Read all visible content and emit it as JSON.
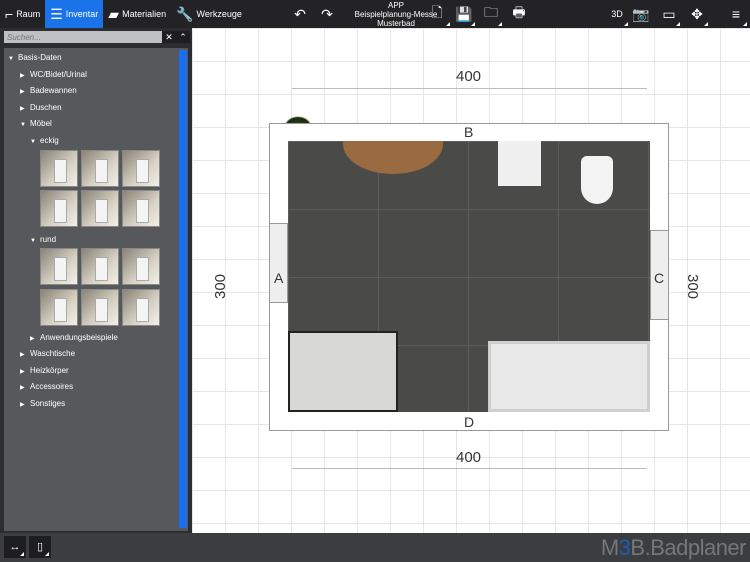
{
  "toolbar": {
    "tabs": [
      {
        "label": "Raum",
        "icon": "room-icon"
      },
      {
        "label": "Inventar",
        "icon": "list-icon",
        "active": true
      },
      {
        "label": "Materialien",
        "icon": "materials-icon"
      },
      {
        "label": "Werkzeuge",
        "icon": "wrench-icon"
      }
    ],
    "project": {
      "line1": "APP",
      "line2": "Beispielplanung-Messe",
      "line3": "Musterbad"
    },
    "view3d": "3D"
  },
  "sidebar": {
    "search_placeholder": "Suchen...",
    "clear": "✕",
    "collapse": "⌃",
    "tree": {
      "root": "Basis-Daten",
      "wc": "WC/Bidet/Urinal",
      "badewannen": "Badewannen",
      "duschen": "Duschen",
      "moebel": "Möbel",
      "eckig": "eckig",
      "rund": "rund",
      "anwendung": "Anwendungsbeispiele",
      "waschtische": "Waschtische",
      "heizkoerper": "Heizkörper",
      "accessoires": "Accessoires",
      "sonstiges": "Sonstiges"
    }
  },
  "plan": {
    "top_dim": "400",
    "bottom_dim": "400",
    "left_dim": "300",
    "right_dim": "300",
    "walls": {
      "a": "A",
      "b": "B",
      "c": "C",
      "d": "D"
    }
  },
  "footer": {
    "logo_pre": "M",
    "logo_mid": "3",
    "logo_post": "B.Badplaner"
  },
  "colors": {
    "accent": "#1a73e8",
    "toolbar": "#232325",
    "panel": "#57585c"
  }
}
